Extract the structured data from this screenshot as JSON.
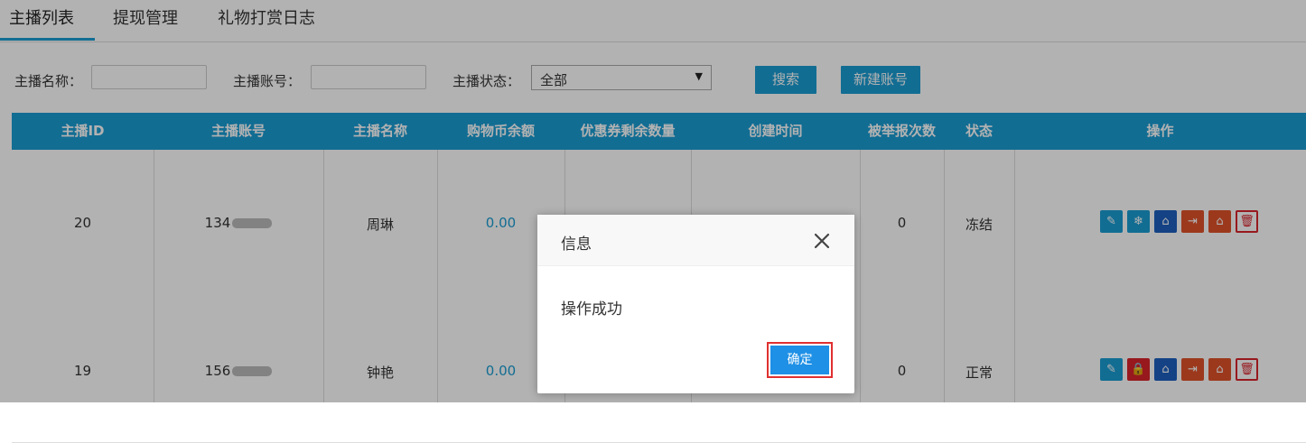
{
  "tabs": [
    {
      "label": "主播列表"
    },
    {
      "label": "提现管理"
    },
    {
      "label": "礼物打赏日志"
    }
  ],
  "search": {
    "name_label": "主播名称：",
    "account_label": "主播账号：",
    "status_label": "主播状态：",
    "status_value": "全部",
    "search_button": "搜索",
    "new_account_button": "新建账号"
  },
  "table": {
    "headers": [
      "主播ID",
      "主播账号",
      "主播名称",
      "购物币余额",
      "优惠券剩余数量",
      "创建时间",
      "被举报次数",
      "状态",
      "操作"
    ],
    "rows": [
      {
        "id": "20",
        "account": "134",
        "name": "周琳",
        "balance": "0.00",
        "reports": "0",
        "status": "冻结"
      },
      {
        "id": "19",
        "account": "156",
        "name": "钟艳",
        "balance": "0.00",
        "reports": "0",
        "status": "正常"
      }
    ]
  },
  "dialog": {
    "title": "信息",
    "message": "操作成功",
    "confirm_label": "确定"
  },
  "colors": {
    "accent": "#1a9dd3",
    "danger": "#d9242b",
    "confirm": "#1e90e6"
  }
}
